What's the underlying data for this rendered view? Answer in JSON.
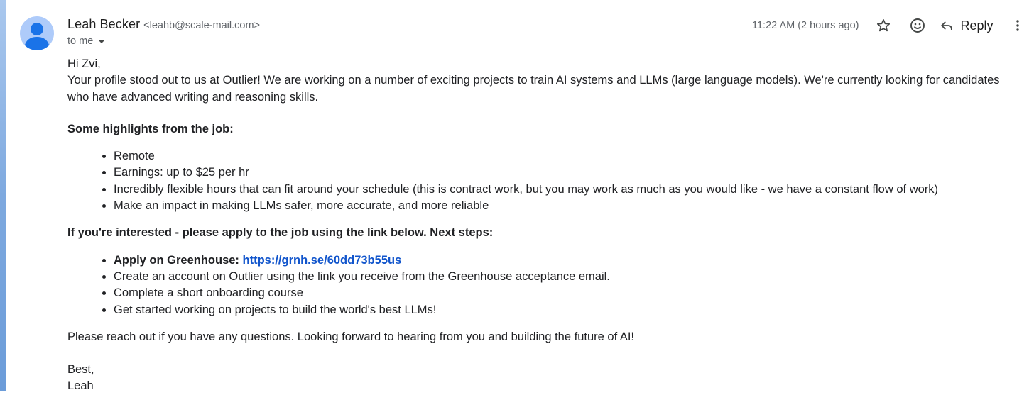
{
  "sender": {
    "name": "Leah Becker",
    "email": "<leahb@scale-mail.com>",
    "recipient_label": "to me"
  },
  "header": {
    "timestamp": "11:22 AM (2 hours ago)",
    "reply_label": "Reply",
    "icons": [
      "star-icon",
      "emoji-icon",
      "reply-icon",
      "more-vert-icon"
    ]
  },
  "message": {
    "greeting": "Hi Zvi,",
    "intro": "Your profile stood out to us at Outlier! We are working on a number of exciting projects to train AI systems and LLMs (large language models). We're currently looking for candidates who have advanced writing and reasoning skills.",
    "highlights_heading": "Some highlights from the job:",
    "highlights": [
      "Remote",
      "Earnings: up to $25 per hr",
      "Incredibly flexible hours that can fit around your schedule (this is contract work, but you may work as much as you would like - we have a constant flow of work)",
      "Make an impact in making LLMs safer, more accurate, and more reliable"
    ],
    "next_steps_heading": "If you're interested - please apply to the job using the link below. Next steps:",
    "steps": {
      "apply_label": "Apply on Greenhouse: ",
      "apply_link": "https://grnh.se/60dd73b55us",
      "step2": "Create an account on Outlier using the link you receive from the Greenhouse acceptance email.",
      "step3": "Complete a short onboarding course",
      "step4": "Get started working on projects to build the world's best LLMs!"
    },
    "closing_line": "Please reach out if you have any questions. Looking forward to hearing from you and building the future of AI!",
    "signoff": "Best,",
    "signature": "Leah"
  },
  "colors": {
    "link": "#1155cc",
    "avatar_bg": "#aecbfa",
    "avatar_fg": "#1a73e8",
    "secondary_text": "#5f6368"
  }
}
